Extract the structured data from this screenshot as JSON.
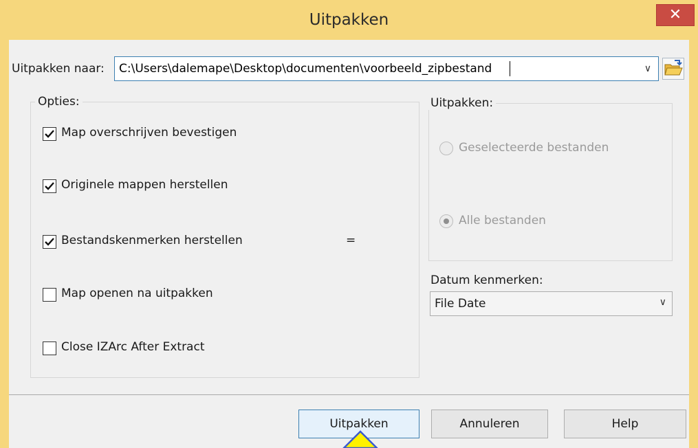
{
  "window": {
    "title": "Uitpakken",
    "close_glyph": "✕"
  },
  "destination": {
    "label": "Uitpakken naar:",
    "value": "C:\\Users\\dalemape\\Desktop\\documenten\\voorbeeld_zipbestand",
    "dropdown_glyph": "∨",
    "browse_icon": "folder-open-icon"
  },
  "options": {
    "title": "Opties:",
    "items": [
      {
        "label": "Map overschrijven bevestigen",
        "checked": true
      },
      {
        "label": "Originele mappen herstellen",
        "checked": true
      },
      {
        "label": "Bestandskenmerken herstellen",
        "checked": true
      },
      {
        "label": "Map openen na uitpakken",
        "checked": false
      },
      {
        "label": "Close IZArc After Extract",
        "checked": false
      }
    ],
    "marker": "="
  },
  "extract": {
    "title": "Uitpakken:",
    "radios": [
      {
        "label": "Geselecteerde bestanden",
        "selected": false
      },
      {
        "label": "Alle bestanden",
        "selected": true
      }
    ]
  },
  "date": {
    "label": "Datum kenmerken:",
    "value": "File Date",
    "chevron": "∨"
  },
  "buttons": {
    "extract": "Uitpakken",
    "cancel": "Annuleren",
    "help": "Help"
  },
  "colors": {
    "titlebar": "#f6d77d",
    "close": "#c94c43",
    "focus": "#3c7fb1"
  }
}
